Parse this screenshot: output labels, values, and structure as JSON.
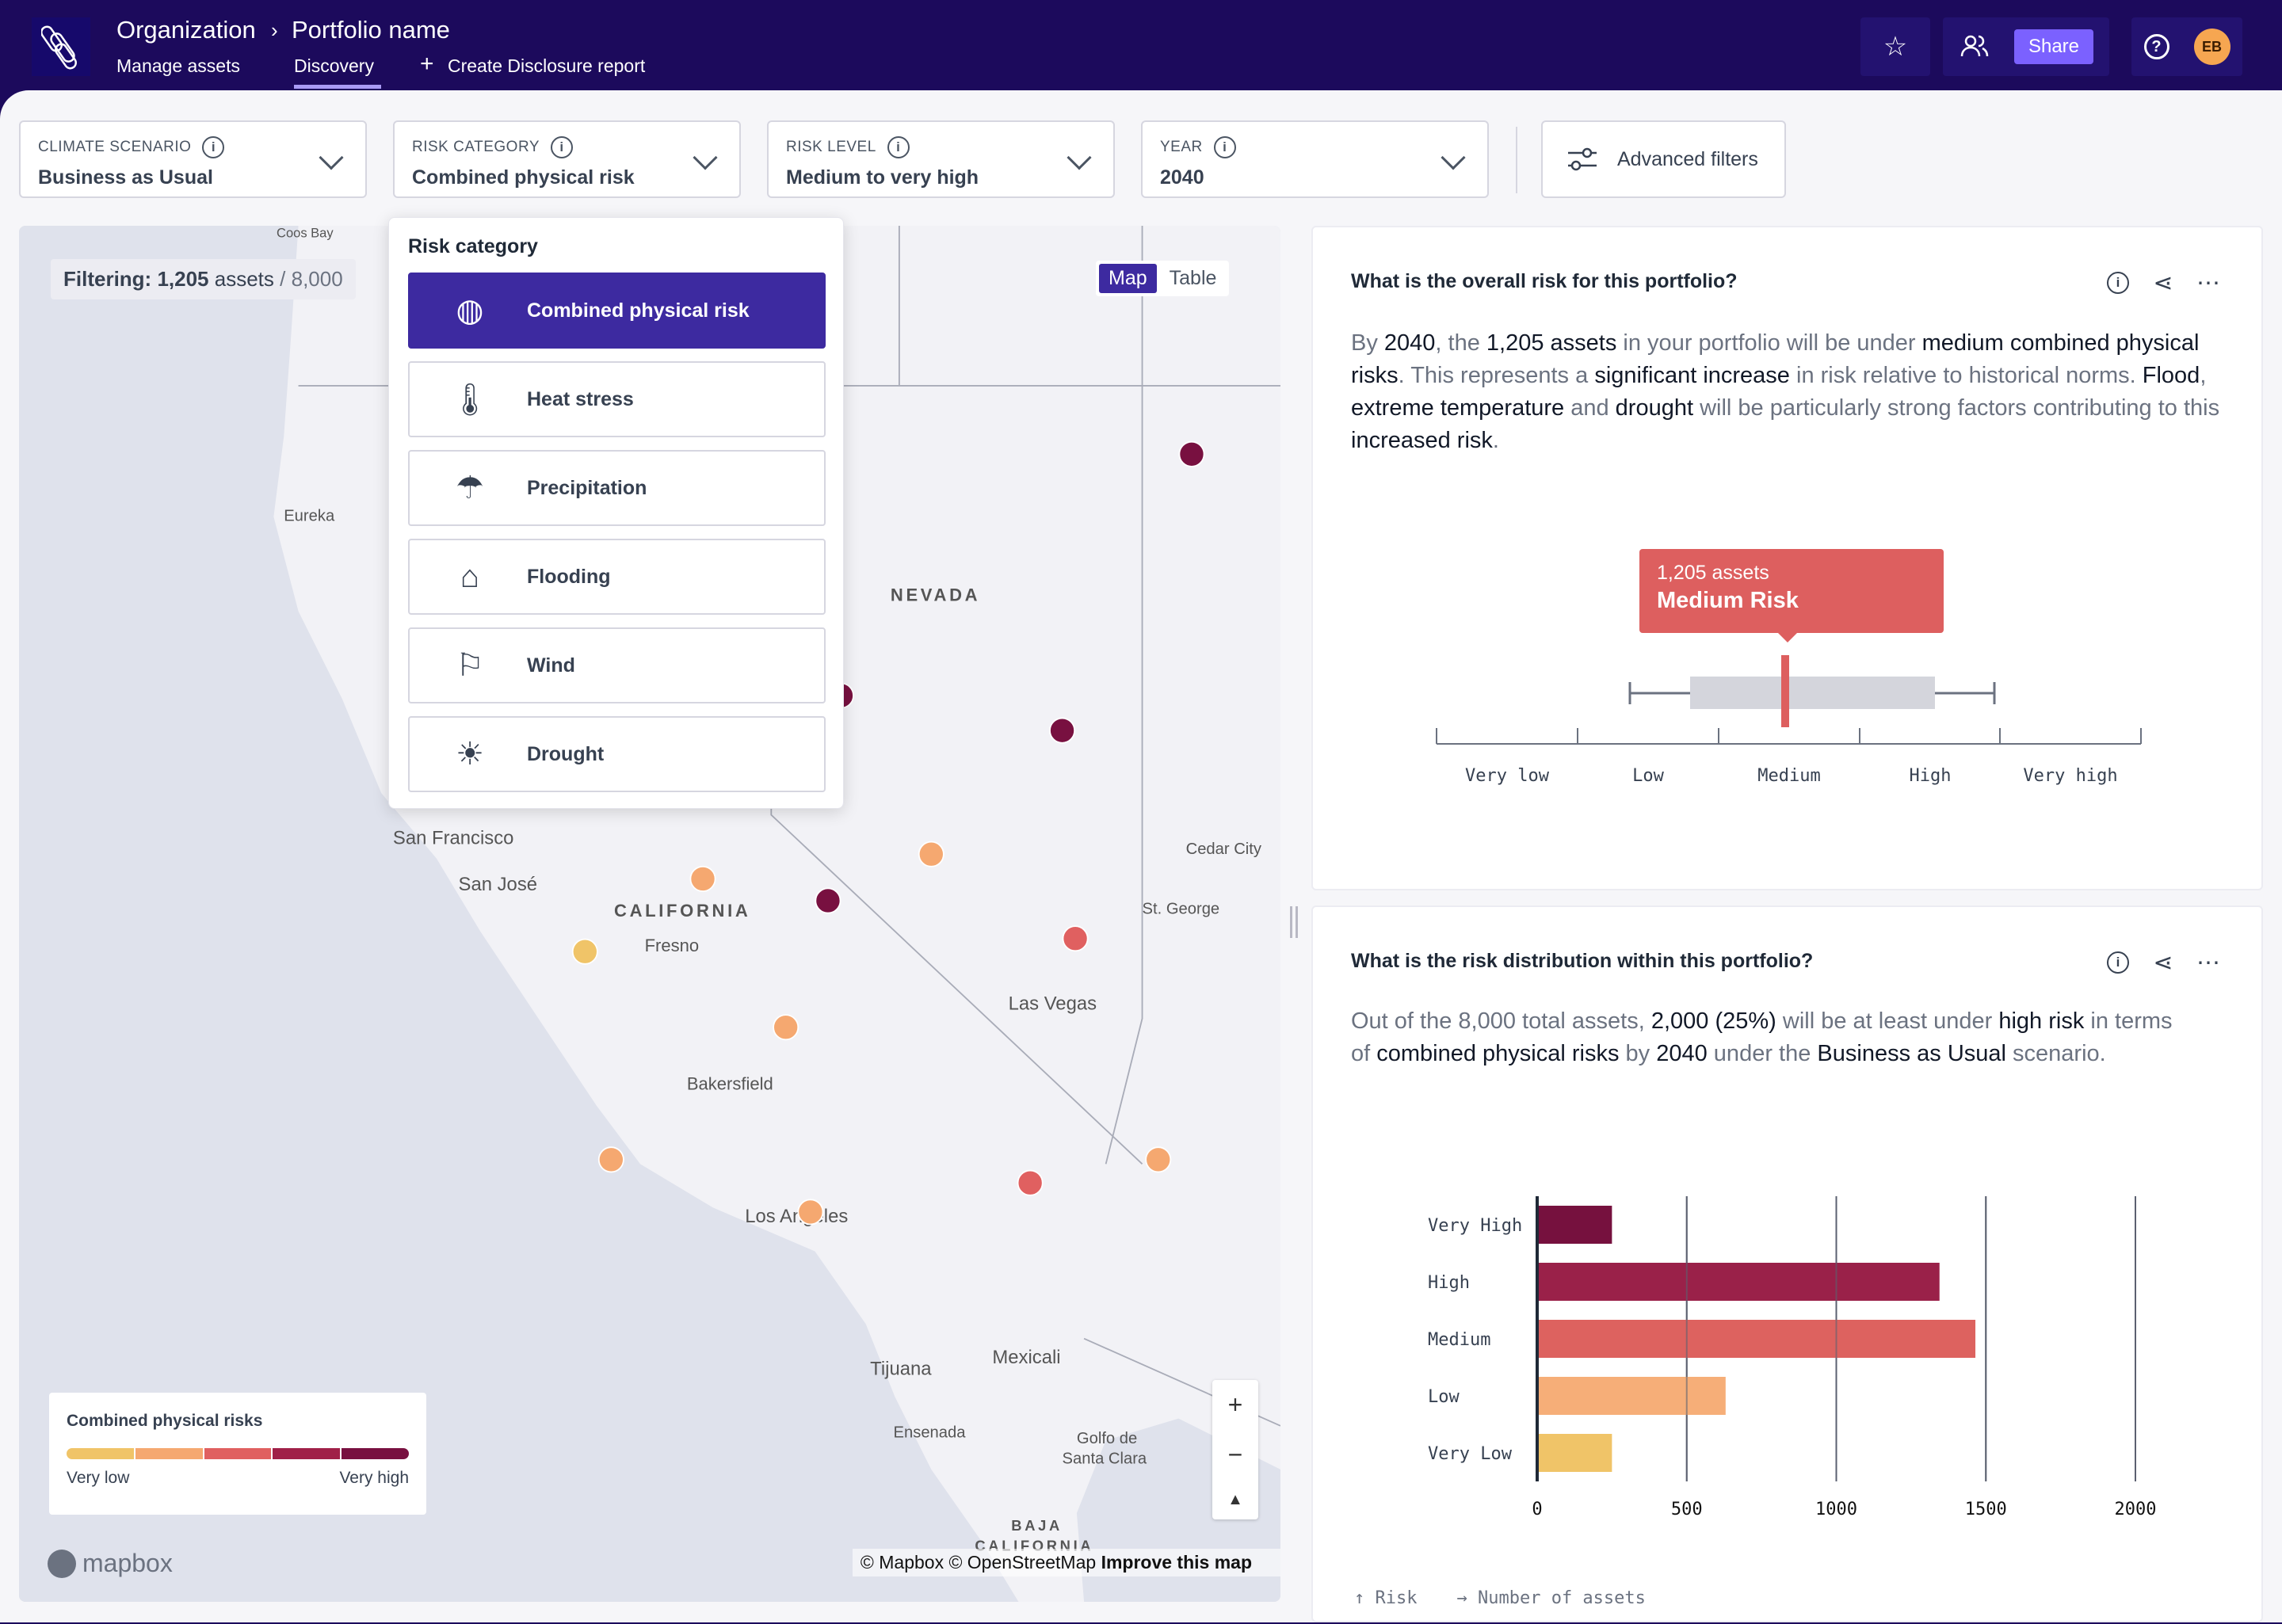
{
  "header": {
    "breadcrumb": [
      "Organization",
      "Portfolio name"
    ],
    "tabs": [
      "Manage assets",
      "Discovery",
      "Create Disclosure report"
    ],
    "active_tab": "Discovery",
    "share_label": "Share",
    "avatar_initials": "EB"
  },
  "filters": [
    {
      "label": "CLIMATE SCENARIO",
      "value": "Business as Usual"
    },
    {
      "label": "RISK CATEGORY",
      "value": "Combined physical risk"
    },
    {
      "label": "RISK LEVEL",
      "value": "Medium to very high"
    },
    {
      "label": "YEAR",
      "value": "2040"
    }
  ],
  "advanced_filters_label": "Advanced filters",
  "map": {
    "filtering_label": "Filtering:",
    "filtered_count": "1,205",
    "assets_word": "assets",
    "total": "/ 8,000",
    "view_toggle": [
      "Map",
      "Table"
    ],
    "active_view": "Map",
    "places": [
      "Coos Bay",
      "Eureka",
      "NEVADA",
      "San Francisco",
      "San José",
      "CALIFORNIA",
      "Fresno",
      "Las Vegas",
      "Cedar City",
      "St. George",
      "Bakersfield",
      "Los Angeles",
      "Tijuana",
      "Mexicali",
      "Ensenada",
      "Golfo de",
      "Santa Clara",
      "BAJA",
      "CALIFORNIA"
    ],
    "legend_title": "Combined physical risks",
    "legend_low": "Very low",
    "legend_high": "Very high",
    "legend_colors": [
      "#f0c468",
      "#f5a870",
      "#e06060",
      "#a02048",
      "#781040"
    ],
    "attribution": "© Mapbox © OpenStreetMap",
    "improve": "Improve this map",
    "brand": "mapbox",
    "zoom_in": "+",
    "zoom_out": "−"
  },
  "risk_dropdown": {
    "title": "Risk category",
    "items": [
      {
        "label": "Combined physical risk",
        "icon": "globe-warning-icon",
        "selected": true
      },
      {
        "label": "Heat stress",
        "icon": "thermometer-icon"
      },
      {
        "label": "Precipitation",
        "icon": "rain-cloud-icon"
      },
      {
        "label": "Flooding",
        "icon": "flood-house-icon"
      },
      {
        "label": "Wind",
        "icon": "windsock-icon"
      },
      {
        "label": "Drought",
        "icon": "drought-icon"
      }
    ]
  },
  "overall": {
    "title": "What is the overall risk for this portfolio?",
    "text": [
      [
        "By ",
        0
      ],
      [
        "2040",
        1
      ],
      [
        ", the ",
        0
      ],
      [
        "1,205 assets",
        1
      ],
      [
        " in your portfolio will be under ",
        0
      ],
      [
        "medium combined physical risks",
        1
      ],
      [
        ". This represents a ",
        0
      ],
      [
        "significant increase",
        1
      ],
      [
        " in risk relative to historical norms. ",
        0
      ],
      [
        "Flood",
        1
      ],
      [
        ", ",
        0
      ],
      [
        "extreme temperature",
        1
      ],
      [
        " and ",
        0
      ],
      [
        "drought",
        1
      ],
      [
        " will be particularly strong factors contributing to this ",
        0
      ],
      [
        "increased risk",
        1
      ],
      [
        ".",
        0
      ]
    ],
    "tooltip_count": "1,205 assets",
    "tooltip_label": "Medium Risk",
    "scale": [
      "Very low",
      "Low",
      "Medium",
      "High",
      "Very high"
    ]
  },
  "distribution": {
    "title": "What is the risk distribution within this portfolio?",
    "text": [
      [
        "Out of the 8,000 total assets, ",
        0
      ],
      [
        "2,000 (25%)",
        1
      ],
      [
        " will be at least under ",
        0
      ],
      [
        "high risk",
        1
      ],
      [
        " in terms of ",
        0
      ],
      [
        "combined physical risks",
        1
      ],
      [
        " by ",
        0
      ],
      [
        "2040",
        1
      ],
      [
        " under the ",
        0
      ],
      [
        "Business as Usual",
        1
      ],
      [
        " scenario.",
        0
      ]
    ],
    "y_axis_legend": "Risk",
    "x_axis_legend": "Number of assets"
  },
  "chart_data": {
    "type": "bar",
    "orientation": "horizontal",
    "categories": [
      "Very High",
      "High",
      "Medium",
      "Low",
      "Very Low"
    ],
    "values": [
      250,
      1345,
      1465,
      630,
      250
    ],
    "colors": [
      "#76113e",
      "#9a2149",
      "#dd625f",
      "#f6ae78",
      "#f0c468"
    ],
    "xlim": [
      0,
      2000
    ],
    "xticks": [
      0,
      500,
      1000,
      1500,
      2000
    ],
    "xlabel": "Number of assets",
    "ylabel": "Risk",
    "grid": true
  }
}
